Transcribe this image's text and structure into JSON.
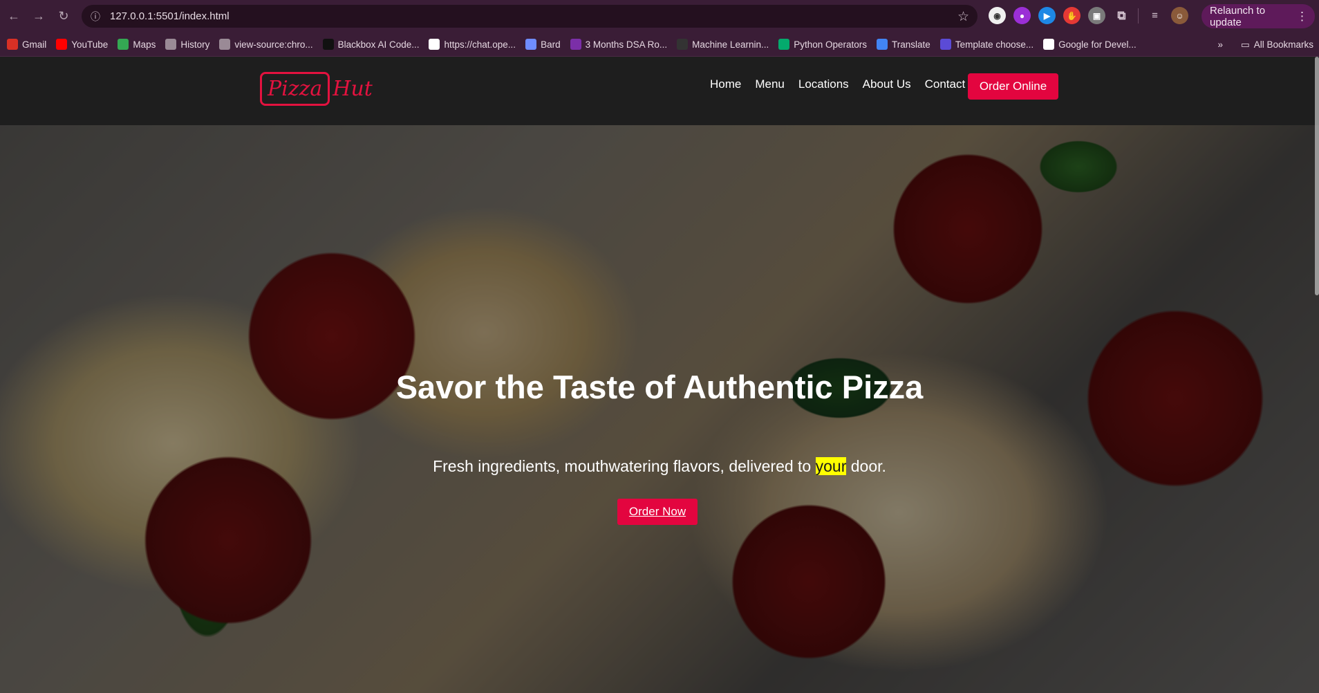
{
  "browser": {
    "url": "127.0.0.1:5501/index.html",
    "relaunch_label": "Relaunch to update",
    "bookmarks": [
      {
        "label": "Gmail",
        "icon": "gmail-icon",
        "color": "#d93025"
      },
      {
        "label": "YouTube",
        "icon": "youtube-icon",
        "color": "#ff0000"
      },
      {
        "label": "Maps",
        "icon": "maps-icon",
        "color": "#34a853"
      },
      {
        "label": "History",
        "icon": "history-icon",
        "color": "#9a8a96"
      },
      {
        "label": "view-source:chro...",
        "icon": "globe-icon",
        "color": "#9a8a96"
      },
      {
        "label": "Blackbox AI Code...",
        "icon": "blackbox-icon",
        "color": "#111111"
      },
      {
        "label": "https://chat.ope...",
        "icon": "openai-icon",
        "color": "#ffffff"
      },
      {
        "label": "Bard",
        "icon": "bard-icon",
        "color": "#6f8cff"
      },
      {
        "label": "3 Months DSA Ro...",
        "icon": "bookmark-icon",
        "color": "#7b2fa8"
      },
      {
        "label": "Machine Learnin...",
        "icon": "ml-icon",
        "color": "#333333"
      },
      {
        "label": "Python Operators",
        "icon": "w3-icon",
        "color": "#04aa6d"
      },
      {
        "label": "Translate",
        "icon": "translate-icon",
        "color": "#4285f4"
      },
      {
        "label": "Template choose...",
        "icon": "template-icon",
        "color": "#5b4bd6"
      },
      {
        "label": "Google for Devel...",
        "icon": "google-icon",
        "color": "#ffffff"
      }
    ],
    "all_bookmarks_label": "All Bookmarks"
  },
  "site": {
    "logo_text_boxed": "Pizza",
    "logo_text_tail": "Hut",
    "nav": [
      "Home",
      "Menu",
      "Locations",
      "About Us",
      "Contact"
    ],
    "order_online_label": "Order Online"
  },
  "hero": {
    "title": "Savor the Taste of Authentic Pizza",
    "subtitle_before": "Fresh ingredients, mouthwatering flavors, delivered to ",
    "subtitle_highlight": "your",
    "subtitle_after": " door.",
    "cta_label": "Order Now"
  },
  "colors": {
    "brand_red": "#e3053f",
    "chrome_bg": "#3a1d36",
    "header_bg": "#1e1e1e",
    "highlight": "#ffff00"
  }
}
